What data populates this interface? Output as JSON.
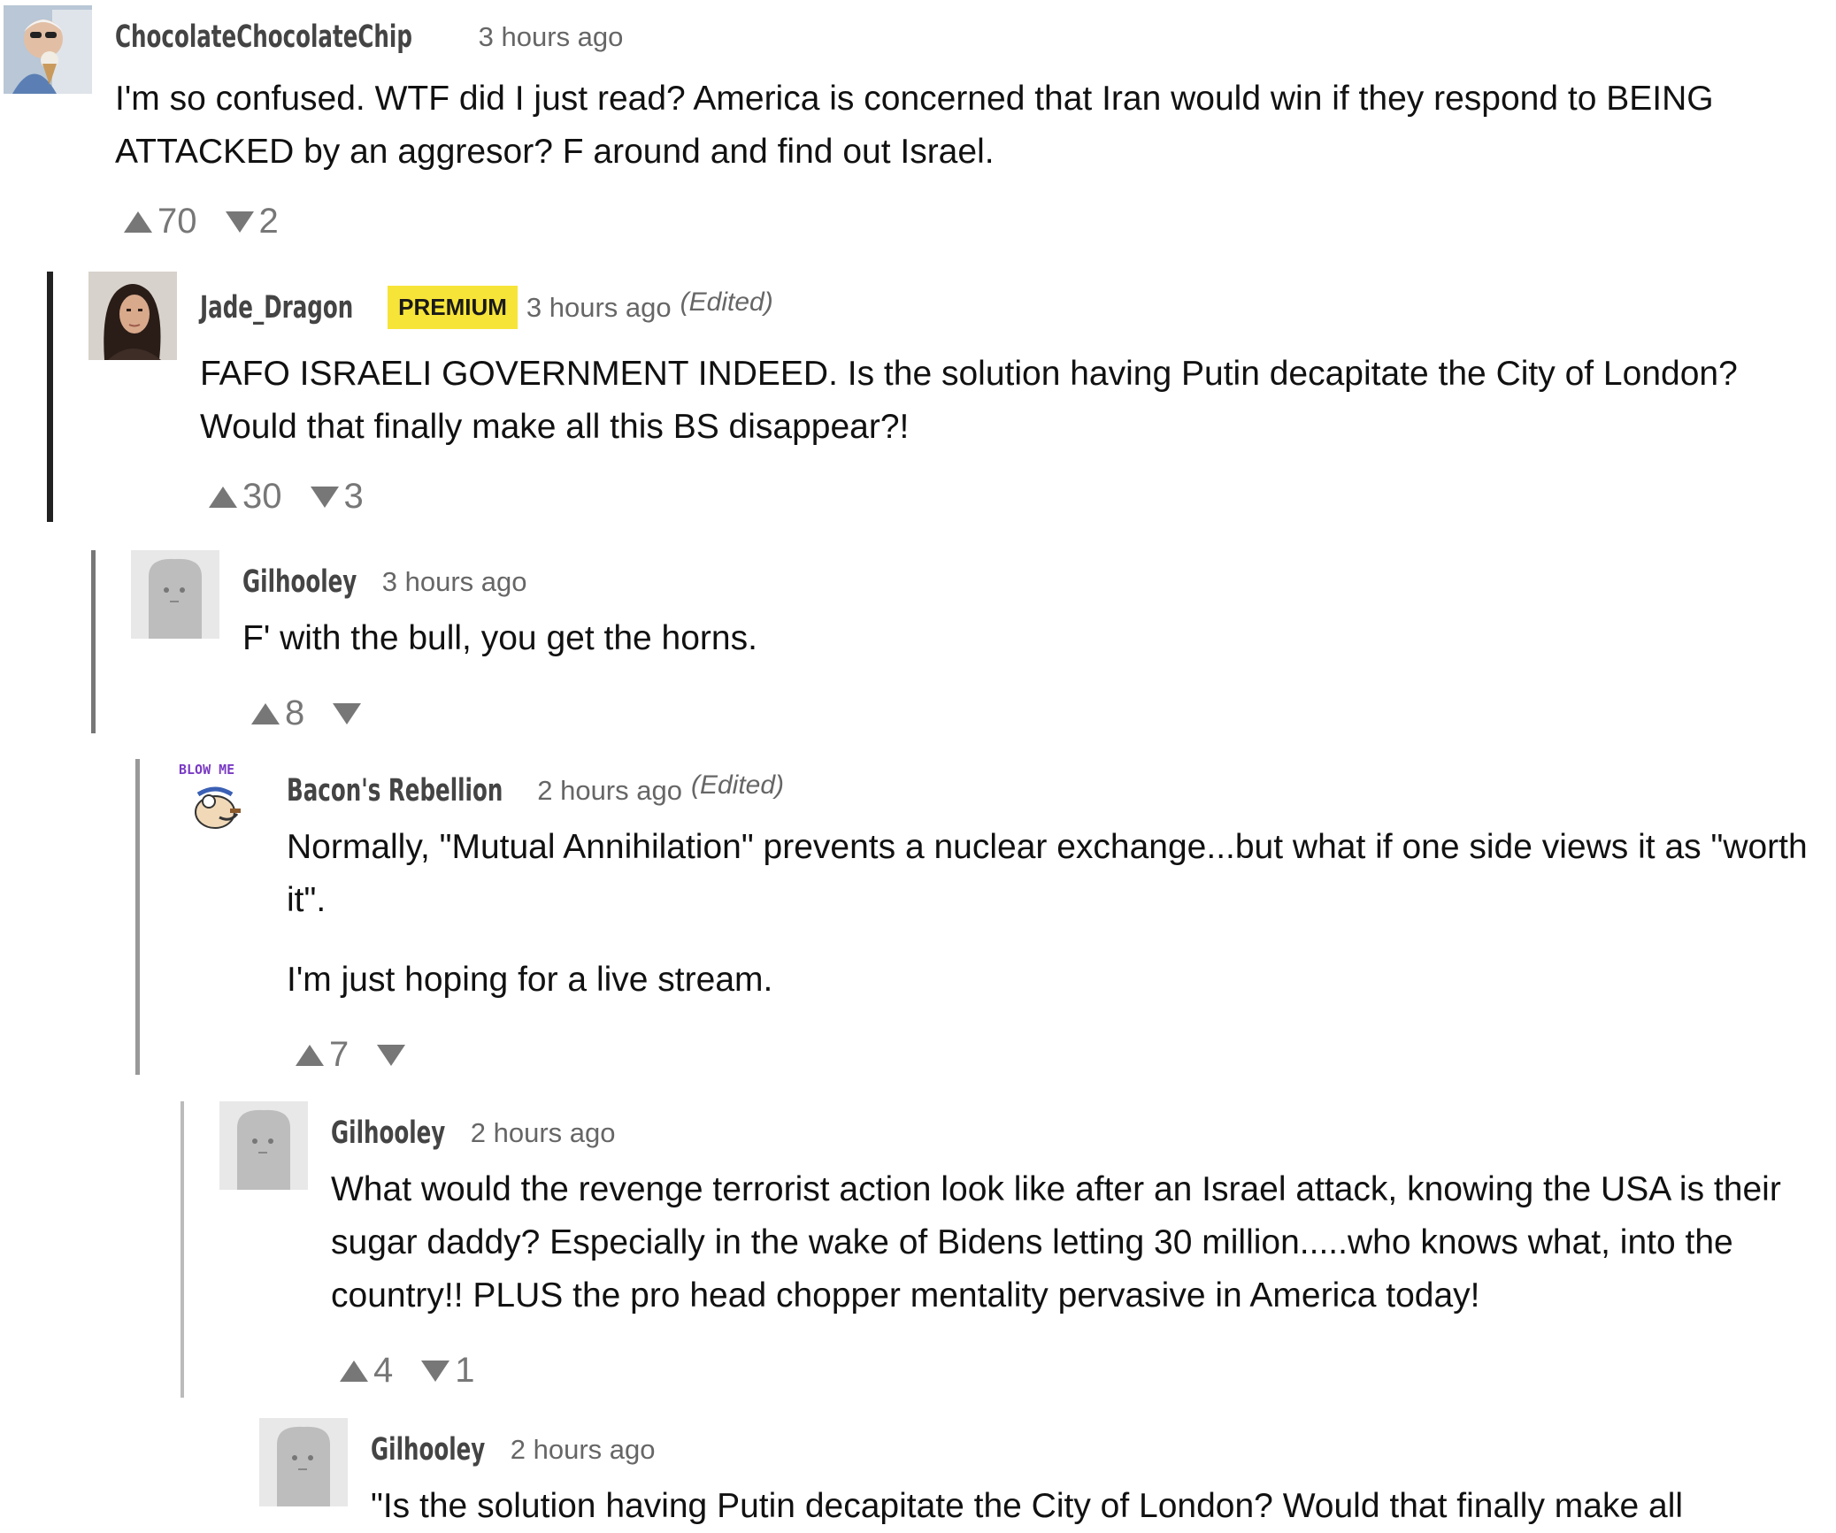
{
  "comments": [
    {
      "user": "ChocolateChocolateChip",
      "time": "3 hours ago",
      "paragraphs": [
        "I'm so confused.  WTF did I just read?  America is concerned that Iran would win if they respond to BEING ATTACKED by an aggresor?  F around and find out Israel."
      ],
      "upvotes": "70",
      "downvotes": "2"
    },
    {
      "user": "Jade_Dragon",
      "badge": "PREMIUM",
      "time": "3 hours ago",
      "edited": "(Edited)",
      "paragraphs": [
        "FAFO ISRAELI GOVERNMENT INDEED. Is the solution having Putin decapitate the City of London? Would that finally make all this BS disappear?!"
      ],
      "upvotes": "30",
      "downvotes": "3"
    },
    {
      "user": "Gilhooley",
      "time": "3 hours ago",
      "paragraphs": [
        "F' with the bull, you get the horns."
      ],
      "upvotes": "8",
      "downvotes": ""
    },
    {
      "user": "Bacon's Rebellion",
      "time": "2 hours ago",
      "edited": "(Edited)",
      "avatar_text": "BLOW ME",
      "paragraphs": [
        "Normally, \"Mutual Annihilation\" prevents a nuclear exchange...but what if one side views it as \"worth it\".",
        "I'm just hoping for a live stream."
      ],
      "upvotes": "7",
      "downvotes": ""
    },
    {
      "user": "Gilhooley",
      "time": "2 hours ago",
      "paragraphs": [
        "What would the revenge terrorist action look like after an Israel attack, knowing the USA is their sugar daddy? Especially in the wake of Bidens letting 30 million.....who knows what, into the country!! PLUS the pro head chopper mentality pervasive in America today!"
      ],
      "upvotes": "4",
      "downvotes": "1"
    },
    {
      "user": "Gilhooley",
      "time": "2 hours ago",
      "paragraphs": [
        "\"Is the solution having Putin decapitate the City of London? Would that finally make all"
      ]
    }
  ],
  "colors": {
    "badge": "#f7e438",
    "vote": "#777777",
    "rail": "#222222"
  }
}
